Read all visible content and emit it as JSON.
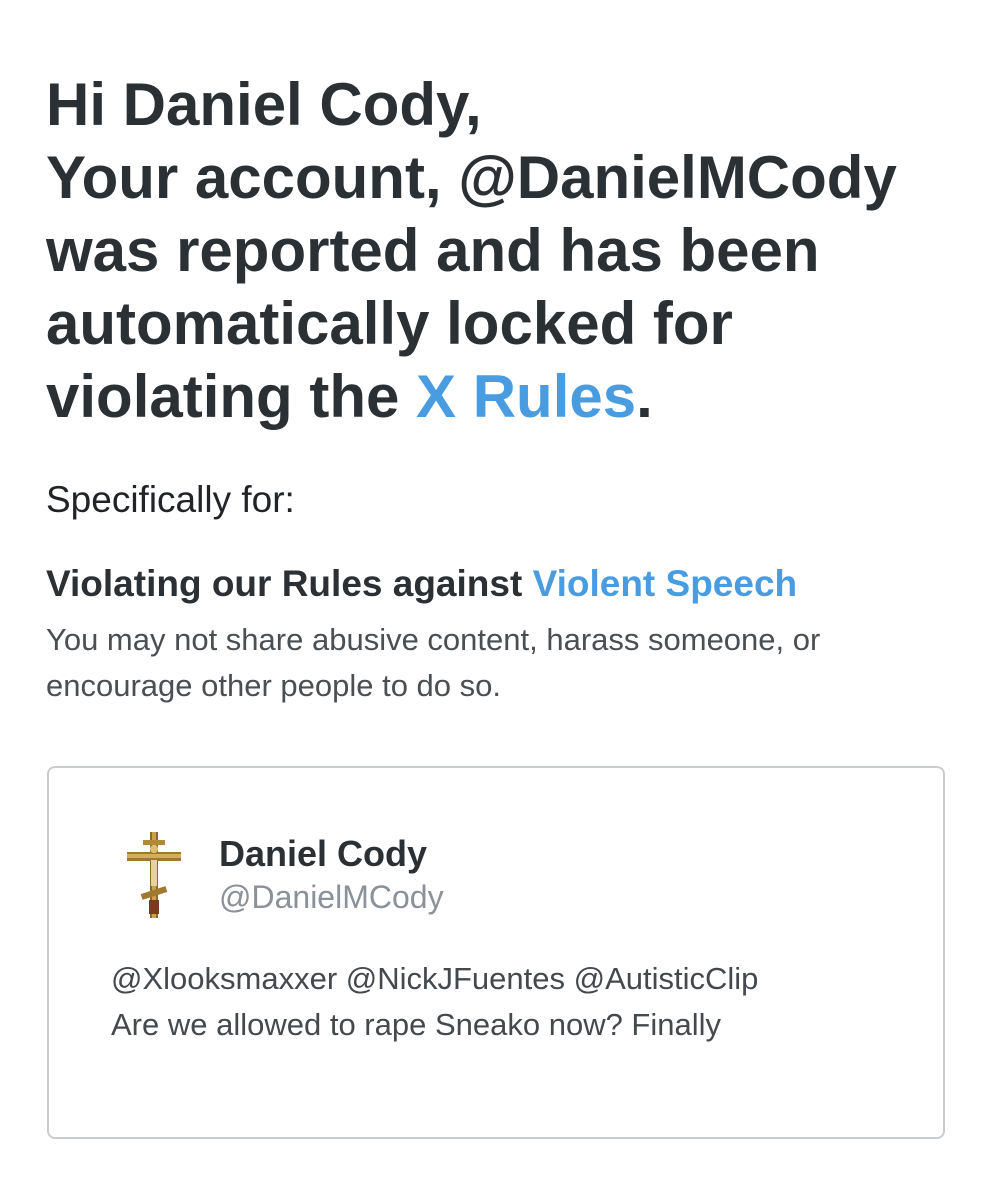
{
  "headline": {
    "line1": "Hi Daniel Cody,",
    "line2": "Your account, @DanielMCody",
    "line3": "was reported and has been",
    "line4": "automatically locked for",
    "line5_prefix": "violating the ",
    "line5_link": "X Rules",
    "line5_suffix": "."
  },
  "specifically_label": "Specifically for:",
  "rule": {
    "title_prefix": "Violating our Rules against ",
    "title_link": "Violent Speech",
    "description_line1": "You may not share abusive content, harass someone, or",
    "description_line2": "encourage other people to do so."
  },
  "tweet": {
    "author_name": "Daniel Cody",
    "author_handle": "@DanielMCody",
    "avatar_icon": "orthodox-cross-icon",
    "text_line1": "@Xlooksmaxxer @NickJFuentes @AutisticClip",
    "text_line2": "Are we allowed to rape Sneako now? Finally"
  },
  "colors": {
    "link": "#4a9ce0",
    "text_dark": "#2b3035",
    "text_muted": "#8a9199",
    "card_border": "#c9cdd1"
  }
}
